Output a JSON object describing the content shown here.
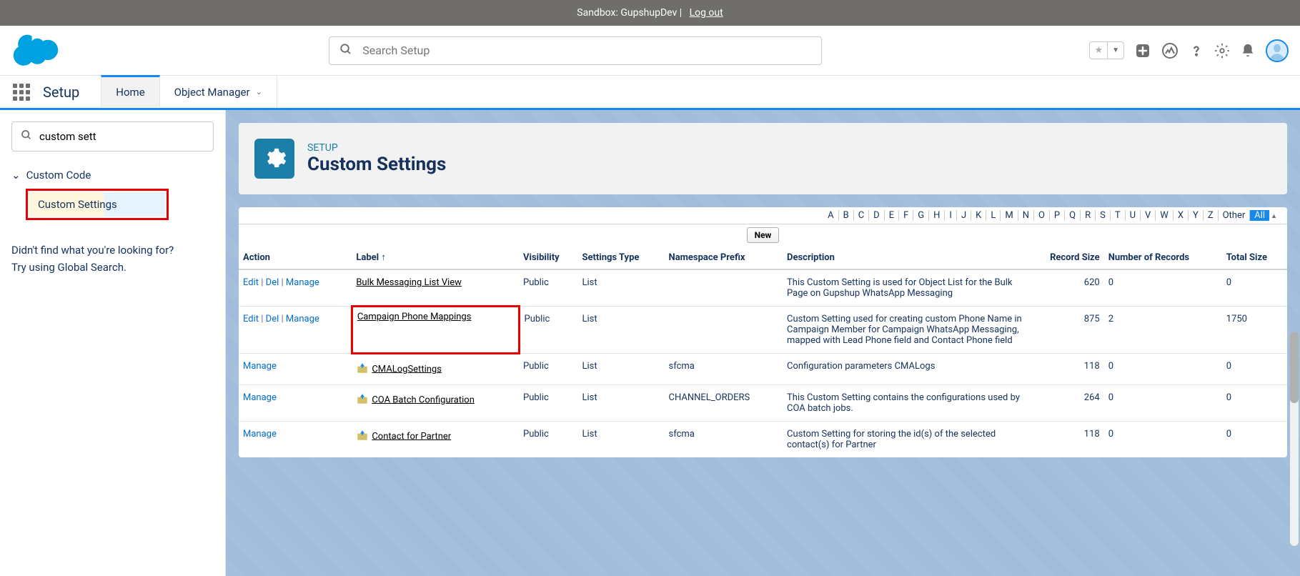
{
  "topbar": {
    "text": "Sandbox: GupshupDev |",
    "logout": "Log out"
  },
  "header": {
    "search_placeholder": "Search Setup"
  },
  "nav": {
    "app": "Setup",
    "tabs": [
      "Home",
      "Object Manager"
    ]
  },
  "sidebar": {
    "search_value": "custom sett",
    "category": "Custom Code",
    "item": "Custom Settings",
    "help1": "Didn't find what you're looking for?",
    "help2": "Try using Global Search."
  },
  "page": {
    "breadcrumb": "SETUP",
    "title": "Custom Settings"
  },
  "alpha": [
    "A",
    "B",
    "C",
    "D",
    "E",
    "F",
    "G",
    "H",
    "I",
    "J",
    "K",
    "L",
    "M",
    "N",
    "O",
    "P",
    "Q",
    "R",
    "S",
    "T",
    "U",
    "V",
    "W",
    "X",
    "Y",
    "Z",
    "Other",
    "All"
  ],
  "new_btn": "New",
  "columns": {
    "action": "Action",
    "label": "Label",
    "sort": "↑",
    "visibility": "Visibility",
    "type": "Settings Type",
    "ns": "Namespace Prefix",
    "desc": "Description",
    "rsize": "Record Size",
    "nrec": "Number of Records",
    "tsize": "Total Size"
  },
  "action_labels": {
    "edit": "Edit",
    "del": "Del",
    "manage": "Manage"
  },
  "rows": [
    {
      "full_actions": true,
      "pkg": false,
      "highlight": false,
      "label": "Bulk Messaging List View",
      "visibility": "Public",
      "type": "List",
      "ns": "",
      "desc": "This Custom Setting is used for Object List for the Bulk Page on Gupshup WhatsApp Messaging",
      "rsize": "620",
      "nrec": "0",
      "tsize": "0"
    },
    {
      "full_actions": true,
      "pkg": false,
      "highlight": true,
      "label": "Campaign Phone Mappings",
      "visibility": "Public",
      "type": "List",
      "ns": "",
      "desc": "Custom Setting used for creating custom Phone Name in Campaign Member for Campaign WhatsApp Messaging, mapped with Lead Phone field and Contact Phone field",
      "rsize": "875",
      "nrec": "2",
      "tsize": "1750"
    },
    {
      "full_actions": false,
      "pkg": true,
      "highlight": false,
      "label": "CMALogSettings",
      "visibility": "Public",
      "type": "List",
      "ns": "sfcma",
      "desc": "Configuration parameters CMALogs",
      "rsize": "118",
      "nrec": "0",
      "tsize": "0"
    },
    {
      "full_actions": false,
      "pkg": true,
      "highlight": false,
      "label": "COA Batch Configuration",
      "visibility": "Public",
      "type": "List",
      "ns": "CHANNEL_ORDERS",
      "desc": "This Custom Setting contains the configurations used by COA batch jobs.",
      "rsize": "264",
      "nrec": "0",
      "tsize": "0"
    },
    {
      "full_actions": false,
      "pkg": true,
      "highlight": false,
      "label": "Contact for Partner",
      "visibility": "Public",
      "type": "List",
      "ns": "sfcma",
      "desc": "Custom Setting for storing the id(s) of the selected contact(s) for Partner",
      "rsize": "118",
      "nrec": "0",
      "tsize": "0"
    }
  ]
}
